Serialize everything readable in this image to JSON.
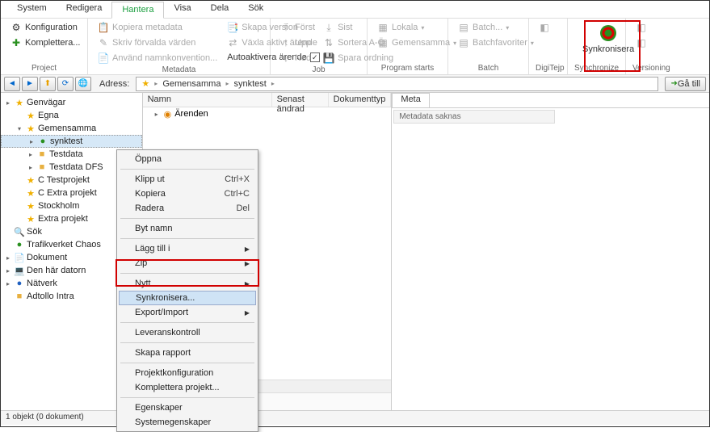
{
  "menu": [
    "System",
    "Redigera",
    "Hantera",
    "Visa",
    "Dela",
    "Sök"
  ],
  "menu_active": 2,
  "ribbon": {
    "project": {
      "label": "Project",
      "konfig": "Konfiguration",
      "kompl": "Komplettera..."
    },
    "metadata": {
      "label": "Metadata",
      "kopiera": "Kopiera metadata",
      "skriv": "Skriv förvalda värden",
      "anvand": "Använd namnkonvention...",
      "auto": "Autoaktivera ärende",
      "skapa": "Skapa version",
      "vaxla": "Växla aktivt ärende"
    },
    "job": {
      "label": "Job",
      "forst": "Först",
      "upp": "Upp",
      "ned": "Ned",
      "sist": "Sist",
      "sortera": "Sortera A-Ö",
      "spara": "Spara ordning"
    },
    "program": {
      "label": "Program starts",
      "lokala": "Lokala",
      "gemen": "Gemensamma"
    },
    "batch": {
      "label": "Batch",
      "batch": "Batch...",
      "fav": "Batchfavoriter"
    },
    "digi": {
      "label": "DigiTejp"
    },
    "sync": {
      "label": "Synchronize",
      "btn": "Synkronisera"
    },
    "ver": {
      "label": "Versioning"
    }
  },
  "toolbar": {
    "adress": "Adress:",
    "crumbs": [
      "Gemensamma",
      "synktest"
    ],
    "gatill": "Gå till"
  },
  "tree": [
    {
      "d": 0,
      "t": "▸",
      "i": "★",
      "c": "star",
      "l": "Genvägar"
    },
    {
      "d": 1,
      "t": "",
      "i": "★",
      "c": "star",
      "l": "Egna"
    },
    {
      "d": 1,
      "t": "▾",
      "i": "★",
      "c": "star",
      "l": "Gemensamma"
    },
    {
      "d": 2,
      "t": "▸",
      "i": "●",
      "c": "green",
      "l": "synktest",
      "sel": true
    },
    {
      "d": 2,
      "t": "▸",
      "i": "■",
      "c": "folder",
      "l": "Testdata"
    },
    {
      "d": 2,
      "t": "▸",
      "i": "■",
      "c": "folder",
      "l": "Testdata DFS"
    },
    {
      "d": 1,
      "t": "",
      "i": "★",
      "c": "star",
      "l": "C Testprojekt"
    },
    {
      "d": 1,
      "t": "",
      "i": "★",
      "c": "star",
      "l": "C Extra projekt"
    },
    {
      "d": 1,
      "t": "",
      "i": "★",
      "c": "star",
      "l": "Stockholm"
    },
    {
      "d": 1,
      "t": "",
      "i": "★",
      "c": "star",
      "l": "Extra projekt"
    },
    {
      "d": 0,
      "t": "",
      "i": "🔍",
      "c": "gray",
      "l": "Sök"
    },
    {
      "d": 0,
      "t": "",
      "i": "●",
      "c": "green",
      "l": "Trafikverket Chaos"
    },
    {
      "d": 0,
      "t": "▸",
      "i": "📄",
      "c": "blue",
      "l": "Dokument"
    },
    {
      "d": 0,
      "t": "▸",
      "i": "💻",
      "c": "gray",
      "l": "Den här datorn"
    },
    {
      "d": 0,
      "t": "▸",
      "i": "●",
      "c": "blue",
      "l": "Nätverk"
    },
    {
      "d": 0,
      "t": "",
      "i": "■",
      "c": "folder",
      "l": "Adtollo Intra"
    }
  ],
  "list": {
    "cols": [
      "Namn",
      "Senast ändrad",
      "Dokumenttyp"
    ],
    "rows": [
      {
        "icon": "●",
        "label": "Ärenden"
      }
    ]
  },
  "meta": {
    "tab": "Meta",
    "msg": "Metadata saknas"
  },
  "ctx": {
    "items": [
      {
        "l": "Öppna"
      },
      {
        "sep": 1
      },
      {
        "l": "Klipp ut",
        "s": "Ctrl+X"
      },
      {
        "l": "Kopiera",
        "s": "Ctrl+C"
      },
      {
        "l": "Radera",
        "s": "Del"
      },
      {
        "sep": 1
      },
      {
        "l": "Byt namn"
      },
      {
        "sep": 1
      },
      {
        "l": "Lägg till i",
        "a": 1
      },
      {
        "l": "Zip",
        "a": 1
      },
      {
        "sep": 1
      },
      {
        "l": "Nytt",
        "a": 1
      },
      {
        "l": "Synkronisera...",
        "hl": true
      },
      {
        "l": "Export/Import",
        "a": 1
      },
      {
        "sep": 1
      },
      {
        "l": "Leveranskontroll"
      },
      {
        "sep": 1
      },
      {
        "l": "Skapa rapport"
      },
      {
        "sep": 1
      },
      {
        "l": "Projektkonfiguration"
      },
      {
        "l": "Komplettera projekt..."
      },
      {
        "sep": 1
      },
      {
        "l": "Egenskaper"
      },
      {
        "l": "Systemegenskaper"
      }
    ]
  },
  "status": "1 objekt (0 dokument)"
}
